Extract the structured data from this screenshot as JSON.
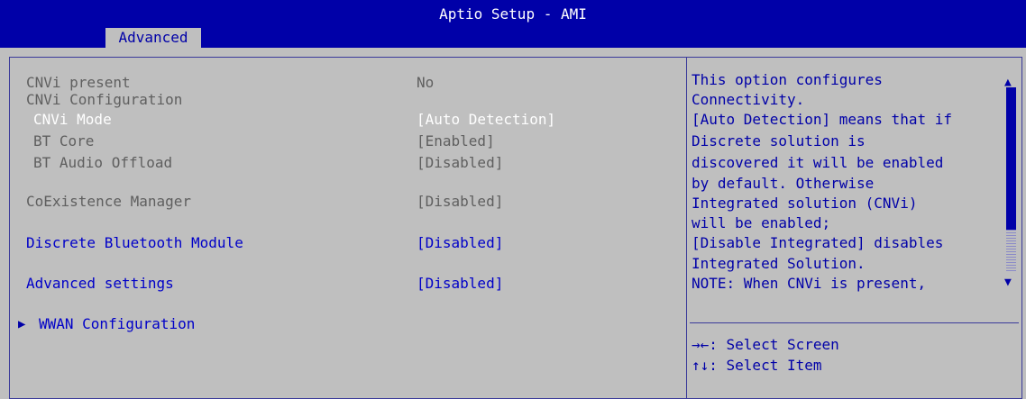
{
  "header": {
    "title": "Aptio Setup - AMI",
    "tab_active": "Advanced"
  },
  "settings": [
    {
      "label": "CNVi present",
      "value": "No"
    },
    {
      "label": "CNVi Configuration",
      "value": ""
    },
    {
      "label": "CNVi Mode",
      "value": "[Auto Detection]"
    },
    {
      "label": "BT Core",
      "value": "[Enabled]"
    },
    {
      "label": "BT Audio Offload",
      "value": "[Disabled]"
    },
    {
      "label": "CoExistence Manager",
      "value": "[Disabled]"
    },
    {
      "label": "Discrete Bluetooth Module",
      "value": "[Disabled]"
    },
    {
      "label": "Advanced settings",
      "value": "[Disabled]"
    },
    {
      "label": "WWAN Configuration",
      "value": ""
    }
  ],
  "help": {
    "lines": [
      "This option configures",
      "Connectivity.",
      "[Auto Detection] means that if",
      "Discrete solution is",
      "discovered it will be enabled",
      "by default. Otherwise",
      "Integrated solution (CNVi)",
      "will be enabled;",
      "[Disable Integrated] disables",
      "Integrated Solution.",
      "NOTE: When CNVi is present,"
    ]
  },
  "keys": [
    "→←: Select Screen",
    "↑↓: Select Item"
  ],
  "icons": {
    "submenu_arrow": "triangle-right-icon",
    "scroll_up": "triangle-up-icon",
    "scroll_down": "triangle-down-icon"
  },
  "colors": {
    "header_bg": "#0000a8",
    "panel_bg": "#bfbfbf",
    "selected_text": "#ffffff",
    "active_item_text": "#0000c8",
    "inactive_text": "#5f5f5f"
  }
}
